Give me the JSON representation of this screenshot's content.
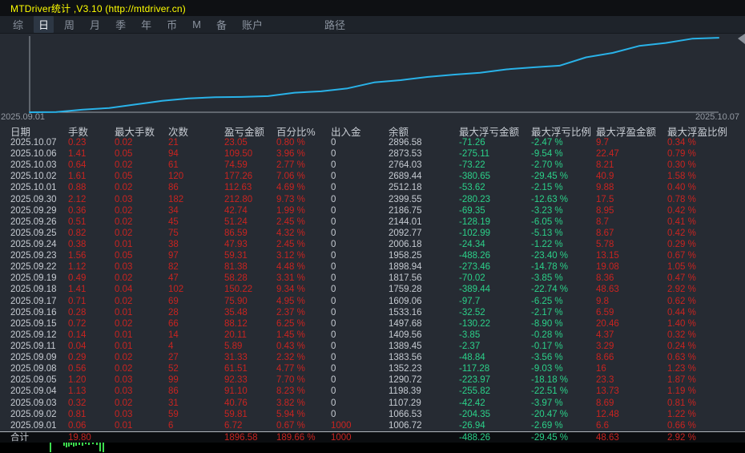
{
  "window": {
    "title": "MTDriver统计 ,V3.10 (http://mtdriver.cn)"
  },
  "menu": {
    "items": [
      {
        "label": "综",
        "selected": false
      },
      {
        "label": "日",
        "selected": true
      },
      {
        "label": "周",
        "selected": false
      },
      {
        "label": "月",
        "selected": false
      },
      {
        "label": "季",
        "selected": false
      },
      {
        "label": "年",
        "selected": false
      },
      {
        "label": "币",
        "selected": false
      },
      {
        "label": "M",
        "selected": false
      },
      {
        "label": "备",
        "selected": false
      },
      {
        "label": "账户",
        "selected": false
      },
      {
        "label": "路径",
        "selected": false,
        "path": true
      }
    ]
  },
  "chart_data": {
    "type": "line",
    "title": "",
    "xlabel": "",
    "ylabel": "",
    "x_start_label": "2025.09.01",
    "x_end_label": "2025.10.07",
    "grid": false,
    "legend": "none",
    "line_color": "#29b2e8",
    "axis_color": "#9aa0a8",
    "ylim": [
      1000,
      2920
    ],
    "baseline_value": 1000,
    "series": [
      {
        "name": "余额",
        "dates": [
          "2025.09.01",
          "2025.09.02",
          "2025.09.03",
          "2025.09.04",
          "2025.09.05",
          "2025.09.08",
          "2025.09.09",
          "2025.09.11",
          "2025.09.12",
          "2025.09.15",
          "2025.09.16",
          "2025.09.17",
          "2025.09.18",
          "2025.09.19",
          "2025.09.22",
          "2025.09.23",
          "2025.09.24",
          "2025.09.25",
          "2025.09.26",
          "2025.09.29",
          "2025.09.30",
          "2025.10.01",
          "2025.10.02",
          "2025.10.03",
          "2025.10.06",
          "2025.10.07"
        ],
        "values": [
          1006.72,
          1066.53,
          1107.29,
          1198.39,
          1290.72,
          1352.23,
          1383.56,
          1389.45,
          1409.56,
          1497.68,
          1533.16,
          1609.06,
          1759.28,
          1817.56,
          1898.94,
          1958.25,
          2006.18,
          2092.77,
          2144.01,
          2186.75,
          2399.55,
          2512.18,
          2689.44,
          2764.03,
          2873.53,
          2896.58
        ]
      }
    ]
  },
  "table": {
    "headers": [
      "日期",
      "手数",
      "最大手数",
      "次数",
      "盈亏金额",
      "百分比%",
      "出入金",
      "余额",
      "最大浮亏金额",
      "最大浮亏比例",
      "最大浮盈金额",
      "最大浮盈比例"
    ],
    "rows": [
      [
        "2025.10.07",
        "0.23",
        "0.02",
        "21",
        "23.05",
        "0.80 %",
        "0",
        "2896.58",
        "-71.26",
        "-2.47 %",
        "9.7",
        "0.34 %"
      ],
      [
        "2025.10.06",
        "1.41",
        "0.05",
        "94",
        "109.50",
        "3.96 %",
        "0",
        "2873.53",
        "-275.11",
        "-9.54 %",
        "22.47",
        "0.79 %"
      ],
      [
        "2025.10.03",
        "0.64",
        "0.02",
        "61",
        "74.59",
        "2.77 %",
        "0",
        "2764.03",
        "-73.22",
        "-2.70 %",
        "8.21",
        "0.30 %"
      ],
      [
        "2025.10.02",
        "1.61",
        "0.05",
        "120",
        "177.26",
        "7.06 %",
        "0",
        "2689.44",
        "-380.65",
        "-29.45 %",
        "40.9",
        "1.58 %"
      ],
      [
        "2025.10.01",
        "0.88",
        "0.02",
        "86",
        "112.63",
        "4.69 %",
        "0",
        "2512.18",
        "-53.62",
        "-2.15 %",
        "9.88",
        "0.40 %"
      ],
      [
        "2025.09.30",
        "2.12",
        "0.03",
        "182",
        "212.80",
        "9.73 %",
        "0",
        "2399.55",
        "-280.23",
        "-12.63 %",
        "17.5",
        "0.78 %"
      ],
      [
        "2025.09.29",
        "0.36",
        "0.02",
        "34",
        "42.74",
        "1.99 %",
        "0",
        "2186.75",
        "-69.35",
        "-3.23 %",
        "8.95",
        "0.42 %"
      ],
      [
        "2025.09.26",
        "0.51",
        "0.02",
        "45",
        "51.24",
        "2.45 %",
        "0",
        "2144.01",
        "-128.19",
        "-6.05 %",
        "8.7",
        "0.41 %"
      ],
      [
        "2025.09.25",
        "0.82",
        "0.02",
        "75",
        "86.59",
        "4.32 %",
        "0",
        "2092.77",
        "-102.99",
        "-5.13 %",
        "8.67",
        "0.42 %"
      ],
      [
        "2025.09.24",
        "0.38",
        "0.01",
        "38",
        "47.93",
        "2.45 %",
        "0",
        "2006.18",
        "-24.34",
        "-1.22 %",
        "5.78",
        "0.29 %"
      ],
      [
        "2025.09.23",
        "1.56",
        "0.05",
        "97",
        "59.31",
        "3.12 %",
        "0",
        "1958.25",
        "-488.26",
        "-23.40 %",
        "13.15",
        "0.67 %"
      ],
      [
        "2025.09.22",
        "1.12",
        "0.03",
        "82",
        "81.38",
        "4.48 %",
        "0",
        "1898.94",
        "-273.46",
        "-14.78 %",
        "19.08",
        "1.05 %"
      ],
      [
        "2025.09.19",
        "0.49",
        "0.02",
        "47",
        "58.28",
        "3.31 %",
        "0",
        "1817.56",
        "-70.02",
        "-3.85 %",
        "8.36",
        "0.47 %"
      ],
      [
        "2025.09.18",
        "1.41",
        "0.04",
        "102",
        "150.22",
        "9.34 %",
        "0",
        "1759.28",
        "-389.44",
        "-22.74 %",
        "48.63",
        "2.92 %"
      ],
      [
        "2025.09.17",
        "0.71",
        "0.02",
        "69",
        "75.90",
        "4.95 %",
        "0",
        "1609.06",
        "-97.7",
        "-6.25 %",
        "9.8",
        "0.62 %"
      ],
      [
        "2025.09.16",
        "0.28",
        "0.01",
        "28",
        "35.48",
        "2.37 %",
        "0",
        "1533.16",
        "-32.52",
        "-2.17 %",
        "6.59",
        "0.44 %"
      ],
      [
        "2025.09.15",
        "0.72",
        "0.02",
        "66",
        "88.12",
        "6.25 %",
        "0",
        "1497.68",
        "-130.22",
        "-8.90 %",
        "20.46",
        "1.40 %"
      ],
      [
        "2025.09.12",
        "0.14",
        "0.01",
        "14",
        "20.11",
        "1.45 %",
        "0",
        "1409.56",
        "-3.85",
        "-0.28 %",
        "4.37",
        "0.32 %"
      ],
      [
        "2025.09.11",
        "0.04",
        "0.01",
        "4",
        "5.89",
        "0.43 %",
        "0",
        "1389.45",
        "-2.37",
        "-0.17 %",
        "3.29",
        "0.24 %"
      ],
      [
        "2025.09.09",
        "0.29",
        "0.02",
        "27",
        "31.33",
        "2.32 %",
        "0",
        "1383.56",
        "-48.84",
        "-3.56 %",
        "8.66",
        "0.63 %"
      ],
      [
        "2025.09.08",
        "0.56",
        "0.02",
        "52",
        "61.51",
        "4.77 %",
        "0",
        "1352.23",
        "-117.28",
        "-9.03 %",
        "16",
        "1.23 %"
      ],
      [
        "2025.09.05",
        "1.20",
        "0.03",
        "99",
        "92.33",
        "7.70 %",
        "0",
        "1290.72",
        "-223.97",
        "-18.18 %",
        "23.3",
        "1.87 %"
      ],
      [
        "2025.09.04",
        "1.13",
        "0.03",
        "86",
        "91.10",
        "8.23 %",
        "0",
        "1198.39",
        "-255.82",
        "-22.51 %",
        "13.73",
        "1.19 %"
      ],
      [
        "2025.09.03",
        "0.32",
        "0.02",
        "31",
        "40.76",
        "3.82 %",
        "0",
        "1107.29",
        "-42.42",
        "-3.97 %",
        "8.69",
        "0.81 %"
      ],
      [
        "2025.09.02",
        "0.81",
        "0.03",
        "59",
        "59.81",
        "5.94 %",
        "0",
        "1066.53",
        "-204.35",
        "-20.47 %",
        "12.48",
        "1.22 %"
      ],
      [
        "2025.09.01",
        "0.06",
        "0.01",
        "6",
        "6.72",
        "0.67 %",
        "1000",
        "1006.72",
        "-26.94",
        "-2.69 %",
        "6.6",
        "0.66 %"
      ]
    ],
    "total_row": [
      "合计",
      "19.80",
      "",
      "",
      "1896.58",
      "189.66 %",
      "1000",
      "",
      "-488.26",
      "-29.45 %",
      "48.63",
      "2.92 %"
    ]
  },
  "footer": {
    "bar_color": "#3ddd4e",
    "bars": [
      [
        62,
        12
      ],
      [
        79,
        4
      ],
      [
        82,
        6
      ],
      [
        85,
        5
      ],
      [
        88,
        3
      ],
      [
        91,
        5
      ],
      [
        94,
        4
      ],
      [
        98,
        3
      ],
      [
        102,
        4
      ],
      [
        106,
        2
      ],
      [
        110,
        3
      ],
      [
        115,
        2
      ],
      [
        120,
        3
      ],
      [
        124,
        11
      ],
      [
        128,
        12
      ]
    ]
  },
  "colors": {
    "accent_line": "#29b2e8",
    "profit_red": "#c92420",
    "drawdown_green": "#2bd189",
    "title_yellow": "#ffff00"
  }
}
